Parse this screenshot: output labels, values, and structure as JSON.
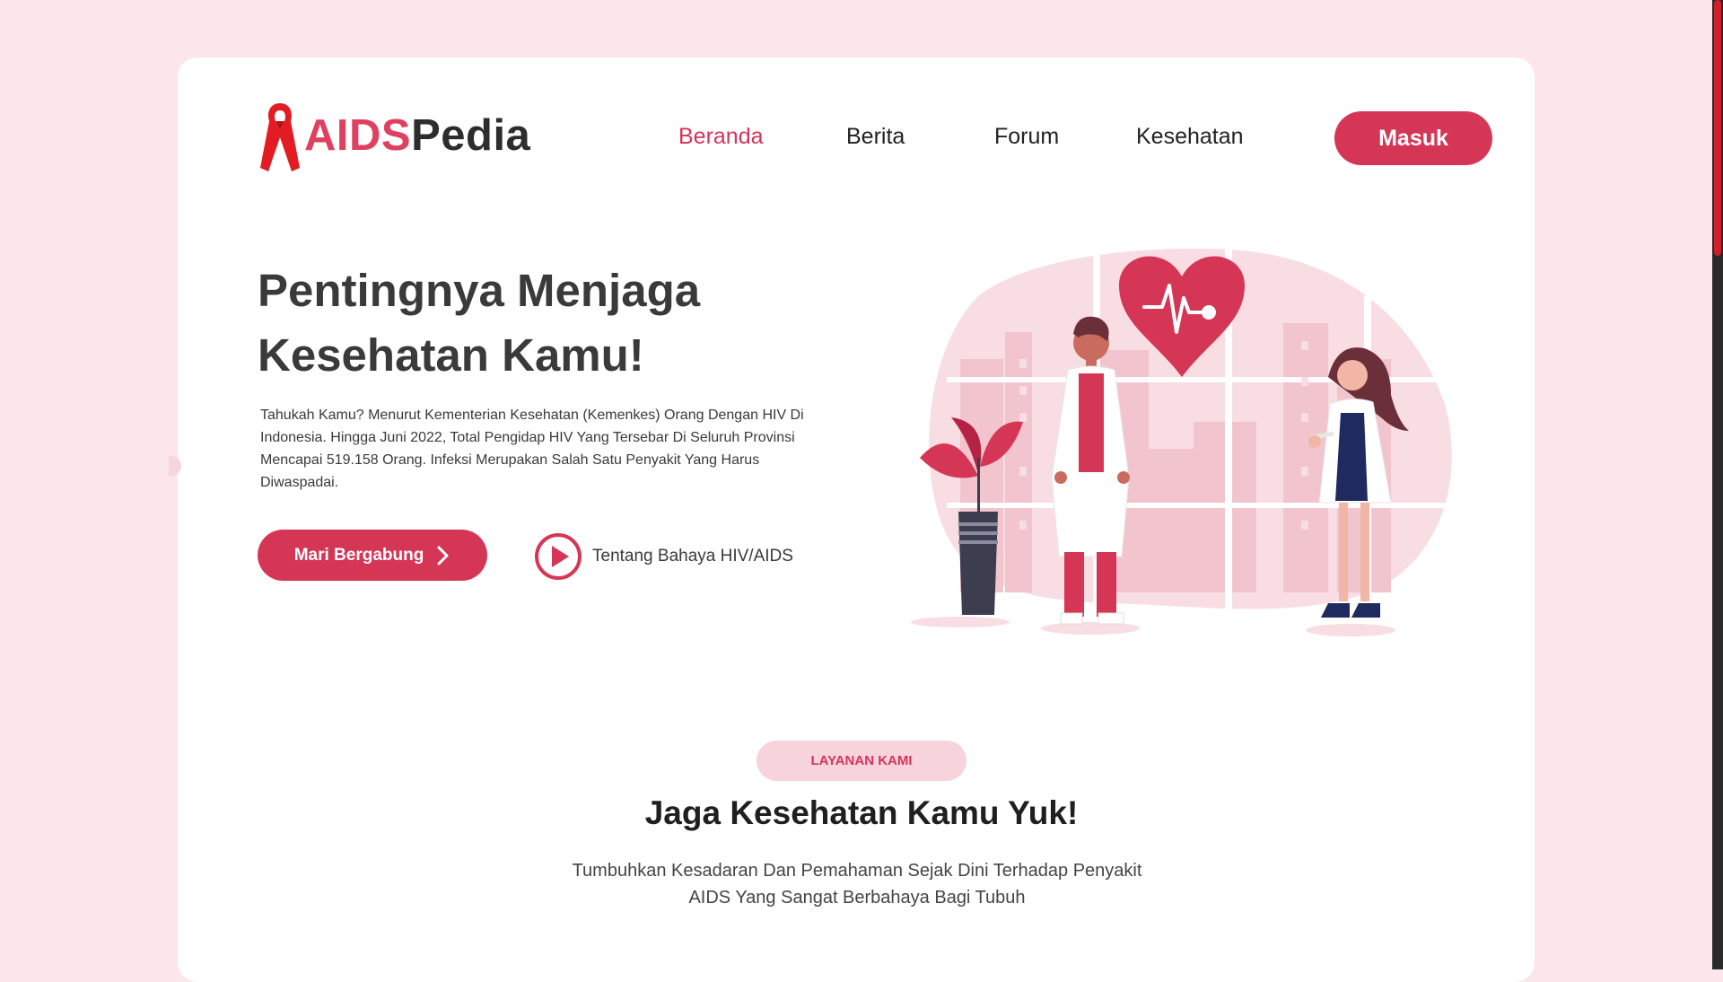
{
  "logo": {
    "part1": "AIDS",
    "part2": "Pedia"
  },
  "nav": {
    "items": [
      {
        "label": "Beranda",
        "active": true
      },
      {
        "label": "Berita"
      },
      {
        "label": "Forum"
      },
      {
        "label": "Kesehatan"
      }
    ],
    "login_label": "Masuk"
  },
  "hero": {
    "title_line1": "Pentingnya Menjaga",
    "title_line2": "Kesehatan Kamu!",
    "description": "Tahukah Kamu? Menurut Kementerian Kesehatan (Kemenkes) Orang Dengan HIV Di Indonesia. Hingga Juni 2022, Total Pengidap HIV Yang Tersebar Di Seluruh Provinsi Mencapai 519.158 Orang. Infeksi Merupakan Salah Satu Penyakit Yang Harus Diwaspadai.",
    "join_label": "Mari Bergabung",
    "video_label": "Tentang Bahaya HIV/AIDS"
  },
  "services": {
    "tag": "LAYANAN KAMI",
    "title": "Jaga Kesehatan Kamu Yuk!",
    "desc_line1": "Tumbuhkan Kesadaran Dan Pemahaman Sejak Dini Terhadap Penyakit",
    "desc_line2": "AIDS Yang Sangat Berbahaya Bagi Tubuh"
  },
  "colors": {
    "accent": "#d63655",
    "background": "#fce6ea",
    "pill": "#f7d3dc",
    "ribbon": "#e31b23"
  }
}
